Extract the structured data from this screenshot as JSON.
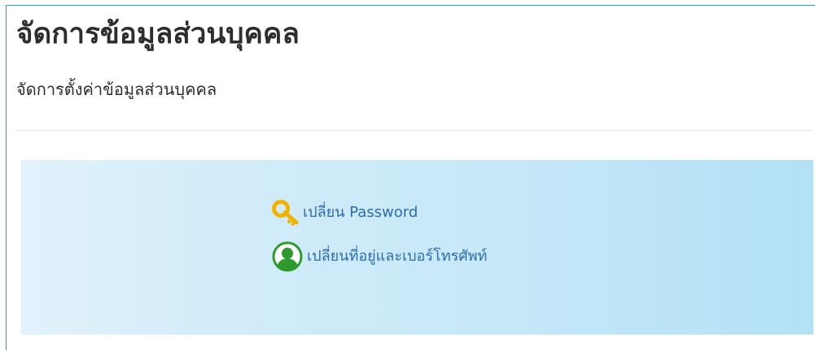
{
  "page": {
    "title": "จัดการข้อมูลส่วนบุคคล",
    "subtitle": "จัดการตั้งค่าข้อมูลส่วนบุคคล"
  },
  "menu": {
    "items": [
      {
        "label": "เปลี่ยน Password",
        "icon": "key-icon"
      },
      {
        "label": "เปลี่ยนที่อยู่และเบอร์โทรศัพท์",
        "icon": "person-circle-icon"
      }
    ]
  },
  "colors": {
    "link": "#2b6cb0",
    "key": "#f0b400",
    "person_icon": "#2e9a2e",
    "panel_start": "#e2f2fb",
    "panel_end": "#b3e1f5",
    "frame_border": "#4f8ac9"
  }
}
